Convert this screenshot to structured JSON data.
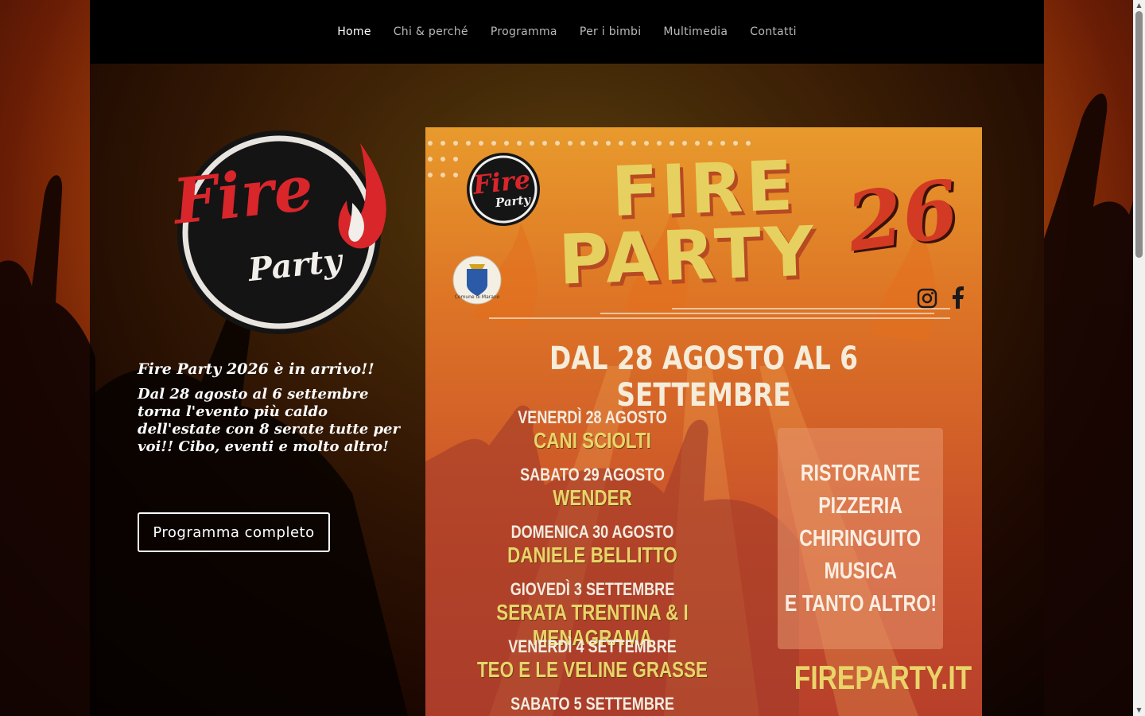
{
  "nav": {
    "items": [
      {
        "label": "Home",
        "active": true
      },
      {
        "label": "Chi & perché",
        "active": false
      },
      {
        "label": "Programma",
        "active": false
      },
      {
        "label": "Per i bimbi",
        "active": false
      },
      {
        "label": "Multimedia",
        "active": false
      },
      {
        "label": "Contatti",
        "active": false
      }
    ]
  },
  "logo": {
    "word1": "Fire",
    "word2": "Party",
    "icon": "flame-icon"
  },
  "hero": {
    "title": "Fire Party 2026 è in arrivo!!",
    "text": "Dal 28 agosto al 6 settembre torna l'evento più caldo dell'estate con 8 serate tutte per voi!! Cibo, eventi e molto altro!",
    "cta_label": "Programma completo"
  },
  "poster": {
    "title_line1": "FIRE",
    "title_line2": "PARTY",
    "year": "26",
    "logo_word1": "Fire",
    "logo_word2": "Party",
    "crest_caption": "Comune di Marano",
    "social": [
      "instagram-icon",
      "facebook-icon"
    ],
    "dates": "DAL 28 AGOSTO AL 6 SETTEMBRE",
    "events": [
      {
        "day": "VENERDÌ 28 AGOSTO",
        "name": "CANI SCIOLTI"
      },
      {
        "day": "SABATO 29 AGOSTO",
        "name": "WENDER"
      },
      {
        "day": "DOMENICA 30 AGOSTO",
        "name": "DANIELE BELLITTO"
      },
      {
        "day": "GIOVEDÌ 3 SETTEMBRE",
        "name": "SERATA TRENTINA & I MENAGRAMA"
      },
      {
        "day": "VENERDÌ 4 SETTEMBRE",
        "name": "TEO E LE VELINE GRASSE"
      },
      {
        "day": "SABATO 5 SETTEMBRE",
        "name": ""
      }
    ],
    "features": [
      "RISTORANTE",
      "PIZZERIA",
      "CHIRINGUITO",
      "MUSICA",
      "E TANTO ALTRO!"
    ],
    "url": "FIREPARTY.IT"
  },
  "colors": {
    "accent_red": "#d8262b",
    "poster_yellow": "#e9d46a",
    "nav_bg": "#000000"
  }
}
